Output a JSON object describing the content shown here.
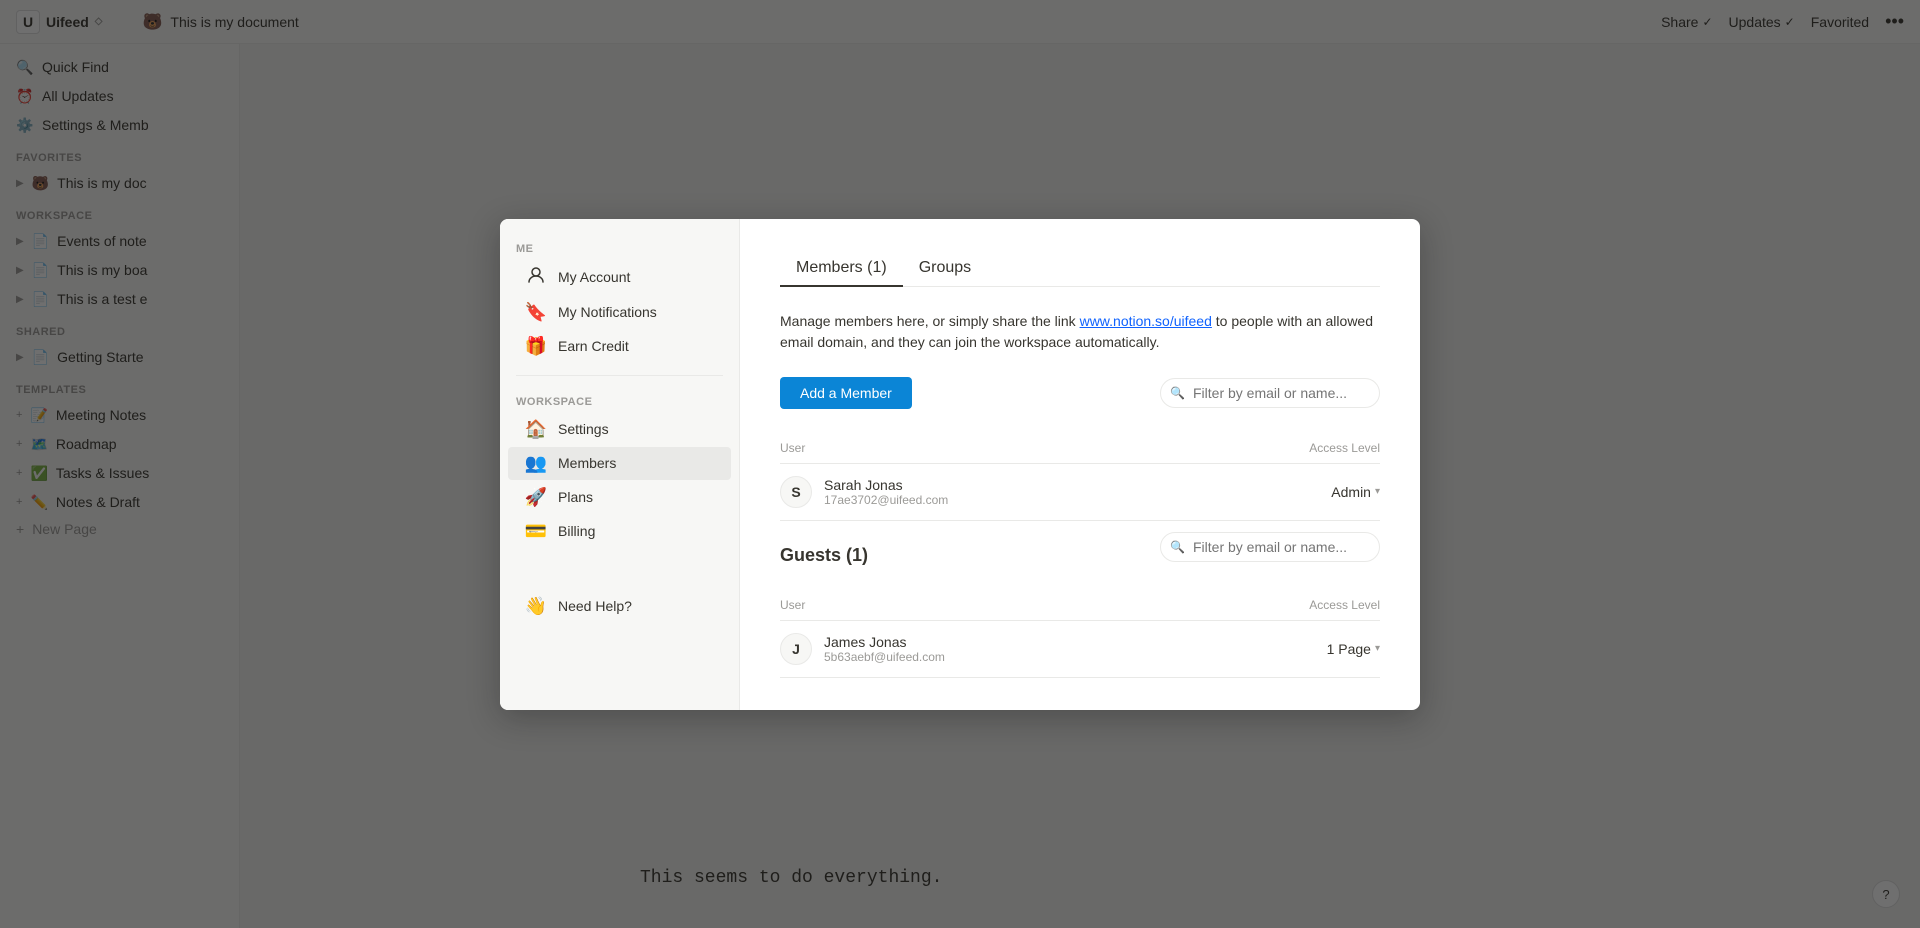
{
  "app": {
    "name": "Uifeed",
    "logo_char": "U"
  },
  "topbar": {
    "doc_icon": "🐻",
    "doc_title": "This is my document",
    "share_label": "Share",
    "updates_label": "Updates",
    "favorited_label": "Favorited",
    "more_icon": "•••"
  },
  "sidebar": {
    "quick_find": "Quick Find",
    "all_updates": "All Updates",
    "settings": "Settings & Memb",
    "favorites_label": "FAVORITES",
    "favorites_item": "This is my doc",
    "favorites_icon": "🐻",
    "workspace_label": "WORKSPACE",
    "workspace_items": [
      {
        "label": "Events of note",
        "icon": "📄"
      },
      {
        "label": "This is my boa",
        "icon": "📄"
      },
      {
        "label": "This is a test e",
        "icon": "📄"
      }
    ],
    "shared_label": "SHARED",
    "shared_item": "Getting Starte",
    "shared_icon": "📄",
    "templates_label": "TEMPLATES",
    "template_items": [
      {
        "label": "Meeting Notes",
        "icon": "📝"
      },
      {
        "label": "Roadmap",
        "icon": "🗺️"
      },
      {
        "label": "Tasks & Issues",
        "icon": "✅"
      },
      {
        "label": "Notes & Draft",
        "icon": "✏️"
      }
    ],
    "new_page": "New Page"
  },
  "page": {
    "body_text": "This seems to do everything."
  },
  "modal": {
    "sidebar": {
      "me_label": "ME",
      "my_account": "My Account",
      "my_account_icon": "👤",
      "my_notifications": "My Notifications",
      "my_notifications_icon": "🔖",
      "earn_credit": "Earn Credit",
      "earn_credit_icon": "🎁",
      "workspace_label": "WORKSPACE",
      "settings": "Settings",
      "settings_icon": "🏠",
      "members": "Members",
      "members_icon": "👥",
      "plans": "Plans",
      "plans_icon": "🚀",
      "billing": "Billing",
      "billing_icon": "💳",
      "need_help": "Need Help?",
      "need_help_icon": "👋"
    },
    "tabs": [
      {
        "label": "Members (1)",
        "active": true
      },
      {
        "label": "Groups",
        "active": false
      }
    ],
    "desc_text": "Manage members here, or simply share the link ",
    "desc_link": "www.notion.so/uifeed",
    "desc_text2": " to people with an allowed email domain, and they can join the workspace automatically.",
    "add_member_btn": "Add a Member",
    "filter_placeholder": "Filter by email or name...",
    "user_col": "User",
    "access_col": "Access Level",
    "members": [
      {
        "name": "Sarah Jonas",
        "email": "17ae3702@uifeed.com",
        "avatar": "S",
        "access": "Admin"
      }
    ],
    "guests_heading": "Guests (1)",
    "guests_filter_placeholder": "Filter by email or name...",
    "guests_user_col": "User",
    "guests_access_col": "Access Level",
    "guests": [
      {
        "name": "James Jonas",
        "email": "5b63aebf@uifeed.com",
        "avatar": "J",
        "access": "1 Page"
      }
    ]
  },
  "help_icon": "?"
}
